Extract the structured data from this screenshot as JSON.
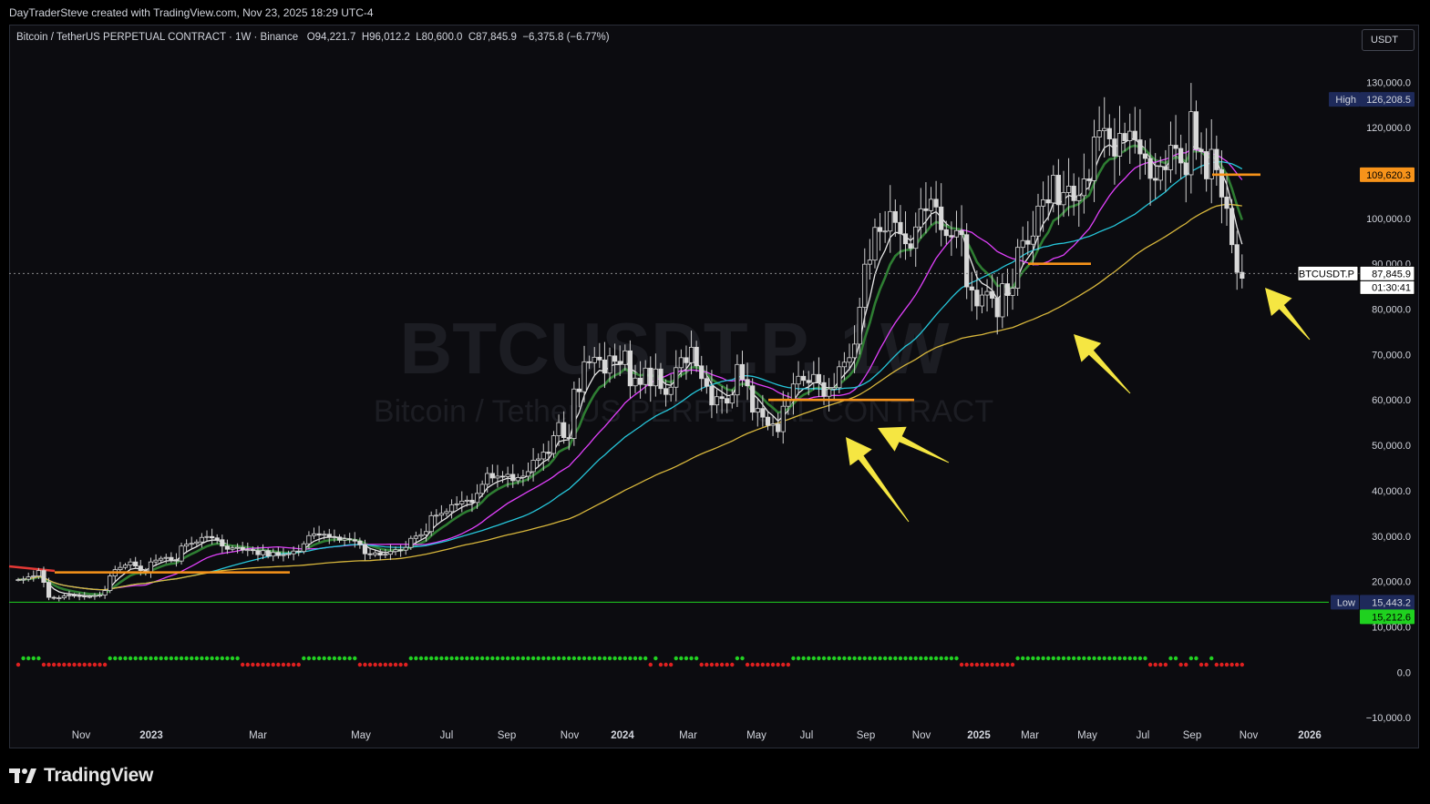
{
  "header": {
    "author_line": "DayTraderSteve created with TradingView.com, Nov 23, 2025 18:29 UTC-4"
  },
  "legend": {
    "symbol": "Bitcoin / TetherUS PERPETUAL CONTRACT · 1W · Binance",
    "open": "O94,221.7",
    "high": "H96,012.2",
    "low": "L80,600.0",
    "close": "C87,845.9",
    "change": "−6,375.8 (−6.77%)"
  },
  "currency_button": "USDT",
  "watermark": {
    "ticker": "BTCUSDT.P, 1W",
    "name": "Bitcoin / TetherUS PERPETUAL CONTRACT"
  },
  "footer": {
    "brand": "TradingView"
  },
  "chart_data": {
    "type": "line",
    "price_axis_ticks": [
      "130,000.0",
      "120,000.0",
      "110,000.0",
      "100,000.0",
      "90,000.0",
      "80,000.0",
      "70,000.0",
      "60,000.0",
      "50,000.0",
      "40,000.0",
      "30,000.0",
      "20,000.0",
      "10,000.0",
      "0.0",
      "−10,000.0"
    ],
    "price_tick_values": [
      130000,
      120000,
      110000,
      100000,
      90000,
      80000,
      70000,
      60000,
      50000,
      40000,
      30000,
      20000,
      10000,
      0,
      -10000
    ],
    "time_axis_labels": [
      {
        "label": "Nov",
        "bold": false
      },
      {
        "label": "2023",
        "bold": true
      },
      {
        "label": "Mar",
        "bold": false
      },
      {
        "label": "May",
        "bold": false
      },
      {
        "label": "Jul",
        "bold": false
      },
      {
        "label": "Sep",
        "bold": false
      },
      {
        "label": "Nov",
        "bold": false
      },
      {
        "label": "2024",
        "bold": true
      },
      {
        "label": "Mar",
        "bold": false
      },
      {
        "label": "May",
        "bold": false
      },
      {
        "label": "Jul",
        "bold": false
      },
      {
        "label": "Sep",
        "bold": false
      },
      {
        "label": "Nov",
        "bold": false
      },
      {
        "label": "2025",
        "bold": true
      },
      {
        "label": "Mar",
        "bold": false
      },
      {
        "label": "May",
        "bold": false
      },
      {
        "label": "Jul",
        "bold": false
      },
      {
        "label": "Sep",
        "bold": false
      },
      {
        "label": "Nov",
        "bold": false
      },
      {
        "label": "2026",
        "bold": true
      }
    ],
    "markers": {
      "high": {
        "label": "High",
        "value": "126,208.5",
        "color": "#1e2a5a"
      },
      "level": {
        "value": "109,620.3",
        "color": "#f7931a"
      },
      "last": {
        "symbol": "BTCUSDT.P",
        "value": "87,845.9",
        "countdown": "01:30:41"
      },
      "low": {
        "label": "Low",
        "value": "15,443.2",
        "color": "#1e2a5a"
      },
      "support": {
        "value": "15,212.6",
        "color": "#1fd11f"
      }
    },
    "candles_close": [
      20400,
      20500,
      21000,
      21200,
      22400,
      19800,
      16500,
      16300,
      16400,
      16800,
      17000,
      16900,
      16800,
      16600,
      16700,
      16900,
      17000,
      18000,
      21200,
      22600,
      23100,
      23600,
      24300,
      23400,
      22400,
      22000,
      24300,
      24700,
      25100,
      25300,
      24800,
      24500,
      27800,
      28200,
      28400,
      28700,
      29700,
      29900,
      29600,
      29200,
      27800,
      27100,
      27400,
      27500,
      26900,
      27000,
      26800,
      25900,
      26800,
      25600,
      26400,
      25700,
      25900,
      26100,
      26700,
      26600,
      28300,
      30100,
      30500,
      30200,
      30400,
      29900,
      29800,
      29100,
      29400,
      29200,
      28900,
      28100,
      26100,
      25900,
      26300,
      25800,
      26000,
      26600,
      27000,
      26900,
      27500,
      29500,
      30000,
      30300,
      31000,
      34500,
      34600,
      35000,
      35400,
      36900,
      37100,
      37700,
      37900,
      37400,
      39400,
      41400,
      43800,
      42800,
      43200,
      43100,
      43600,
      42200,
      42900,
      43200,
      44200,
      46700,
      47000,
      48500,
      48200,
      52100,
      55000,
      51700,
      51500,
      62400,
      61800,
      68400,
      68200,
      69400,
      68800,
      65900,
      69700,
      68500,
      67800,
      70800,
      63100,
      64800,
      63400,
      67000,
      63100,
      66800,
      62500,
      61200,
      62800,
      67100,
      69300,
      68200,
      71600,
      67500,
      64700,
      63000,
      58900,
      60700,
      60300,
      59300,
      61100,
      67800,
      64500,
      63100,
      57300,
      58100,
      56200,
      54400,
      54700,
      53000,
      58600,
      60100,
      63500,
      65200,
      64300,
      63800,
      65600,
      63800,
      60800,
      62400,
      62700,
      67300,
      68300,
      69300,
      72300,
      80400,
      89900,
      90800,
      98000,
      97100,
      97200,
      101500,
      99100,
      96600,
      94400,
      93400,
      98100,
      102100,
      101700,
      104200,
      102500,
      97500,
      96200,
      95900,
      97300,
      96400,
      84900,
      84200,
      80700,
      83100,
      83900,
      82400,
      78300,
      85600,
      83000,
      84600,
      93600,
      95100,
      94300,
      96100,
      102700,
      104100,
      103400,
      109500,
      103000,
      105700,
      107100,
      103900,
      105000,
      108700,
      108300,
      117900,
      119300,
      119800,
      117500,
      113700,
      118700,
      117100,
      119200,
      117300,
      114200,
      113200,
      108800,
      108400,
      111400,
      110700,
      116100,
      115400,
      112200,
      109600,
      123500,
      115200,
      114700,
      108700,
      115200,
      110700,
      104700,
      102200,
      94200,
      88100,
      86800
    ],
    "ma_lines": [
      {
        "name": "fast",
        "color": "#e8e8e8"
      },
      {
        "name": "trend",
        "color": "#2e7d32"
      },
      {
        "name": "mid",
        "color": "#e040fb"
      },
      {
        "name": "slow",
        "color": "#26c6da"
      },
      {
        "name": "long",
        "color": "#d8b73c"
      }
    ],
    "annotations": [
      "arrow-1",
      "arrow-2",
      "arrow-3",
      "arrow-4",
      "arrow-5"
    ],
    "grid": false,
    "log_scale": false
  }
}
